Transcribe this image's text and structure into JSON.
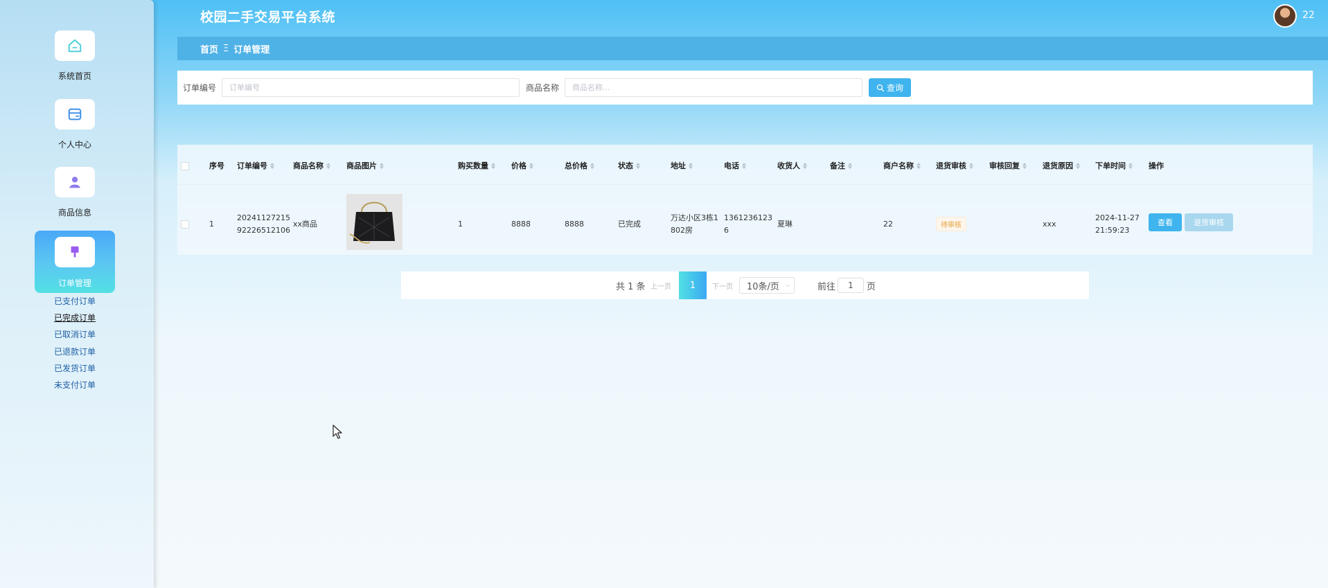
{
  "app": {
    "title": "校园二手交易平台系统",
    "username": "22"
  },
  "sidebar": {
    "items": [
      {
        "label": "系统首页",
        "icon": "home-icon"
      },
      {
        "label": "个人中心",
        "icon": "wallet-icon"
      },
      {
        "label": "商品信息",
        "icon": "user-icon"
      },
      {
        "label": "订单管理",
        "icon": "pin-icon",
        "active": true
      }
    ],
    "submenu": [
      "已支付订单",
      "已完成订单",
      "已取消订单",
      "已退款订单",
      "已发货订单",
      "未支付订单"
    ],
    "submenu_current": "已完成订单"
  },
  "breadcrumb": {
    "home": "首页",
    "separator": "Ξ",
    "current": "订单管理"
  },
  "search": {
    "order_no_label": "订单编号",
    "order_no_placeholder": "订单编号",
    "goods_name_label": "商品名称",
    "goods_name_placeholder": "商品名称...",
    "query_button": "查询"
  },
  "table": {
    "columns": [
      "序号",
      "订单编号",
      "商品名称",
      "商品图片",
      "购买数量",
      "价格",
      "总价格",
      "状态",
      "地址",
      "电话",
      "收货人",
      "备注",
      "商户名称",
      "退货审核",
      "审核回复",
      "退货原因",
      "下单时间",
      "操作"
    ],
    "rows": [
      {
        "index": "1",
        "order_no_line1": "20241127215",
        "order_no_line2": "92226512106",
        "goods_name": "xx商品",
        "quantity": "1",
        "price": "8888",
        "total": "8888",
        "status": "已完成",
        "address_line1": "万达小区3栋1",
        "address_line2": "802房",
        "phone_line1": "1361236123",
        "phone_line2": "6",
        "receiver": "夏琳",
        "remark": "",
        "merchant": "22",
        "return_audit": "待审核",
        "audit_reply": "",
        "return_reason": "xxx",
        "order_date": "2024-11-27",
        "order_time": "21:59:23",
        "actions": {
          "view": "查看",
          "refund_audit": "退货审核"
        }
      }
    ]
  },
  "pagination": {
    "total_text": "共 1 条",
    "prev": "上一页",
    "current_page": "1",
    "next": "下一页",
    "page_size": "10条/页",
    "goto_label": "前往",
    "goto_value": "1",
    "page_unit": "页"
  },
  "colors": {
    "accent": "#3fb4ee",
    "breadcrumb_bg": "#4fb2e6",
    "warning": "#e6a23c"
  }
}
